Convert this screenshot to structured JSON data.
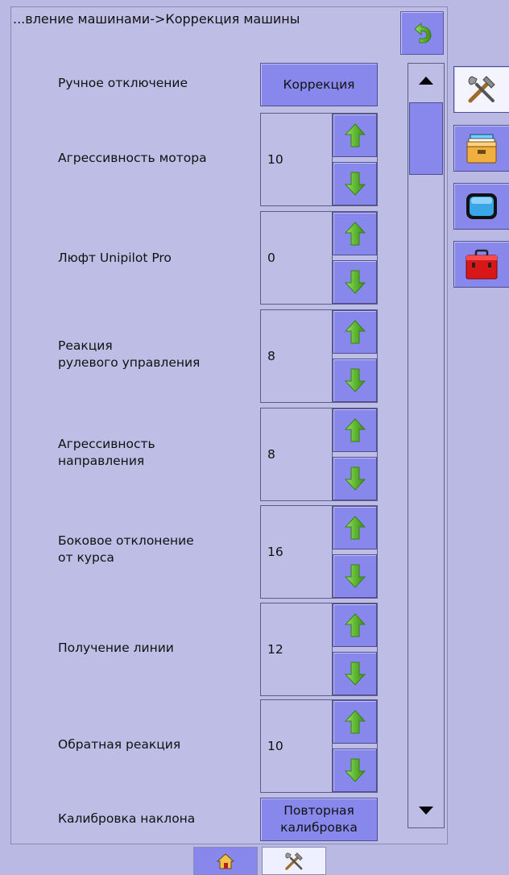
{
  "header": {
    "breadcrumb": "...вление машинами->Коррекция машины"
  },
  "settings": {
    "manual_disconnect": {
      "label": "Ручное отключение",
      "button": "Коррекция"
    },
    "rows": [
      {
        "label": "Агрессивность мотора",
        "value": "10"
      },
      {
        "label": "Люфт Unipilot Pro",
        "value": "0"
      },
      {
        "label": "Реакция\nрулевого управления",
        "value": "8"
      },
      {
        "label": "Агрессивность\nнаправления",
        "value": "8"
      },
      {
        "label": "Боковое отклонение\nот курса",
        "value": "16"
      },
      {
        "label": "Получение линии",
        "value": "12"
      },
      {
        "label": "Обратная реакция",
        "value": "10"
      }
    ],
    "tilt": {
      "label": "Калибровка наклона",
      "button": "Повторная\nкалибровка"
    }
  },
  "sidebar": {
    "items": [
      {
        "icon": "tools-icon",
        "active": true
      },
      {
        "icon": "storage-box-icon",
        "active": false
      },
      {
        "icon": "display-icon",
        "active": false
      },
      {
        "icon": "toolbox-icon",
        "active": false
      }
    ]
  },
  "bottom_tabs": [
    {
      "icon": "home-icon",
      "active": false
    },
    {
      "icon": "tools-icon",
      "active": true
    }
  ],
  "colors": {
    "background": "#b9b9e3",
    "button": "#8888ec",
    "arrow_green": "#6cc23a"
  }
}
